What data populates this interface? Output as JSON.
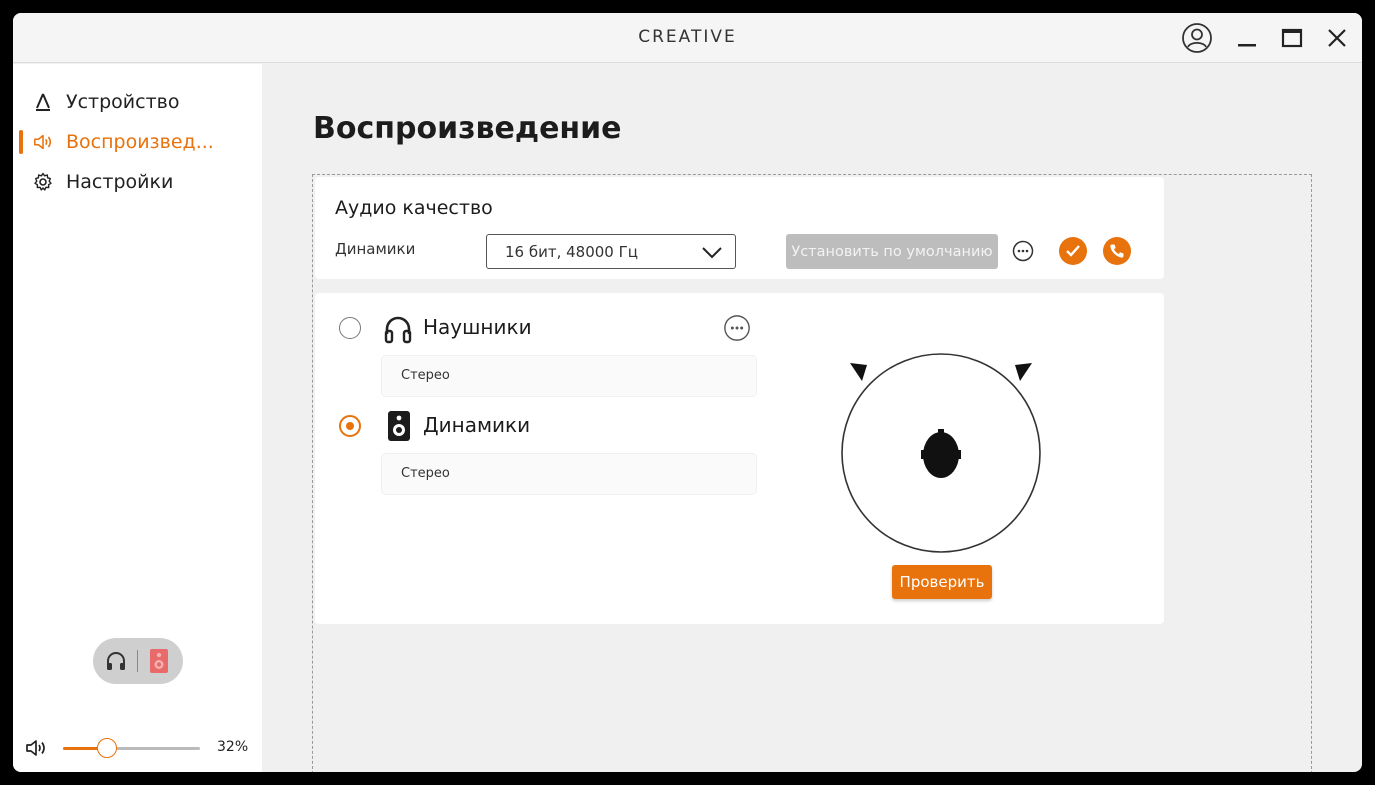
{
  "app": {
    "brand": "CREATIVE"
  },
  "sidebar": {
    "items": [
      {
        "label": "Устройство",
        "icon": "device-icon",
        "active": false
      },
      {
        "label": "Воспроизвед...",
        "icon": "speaker-volume-icon",
        "active": true
      },
      {
        "label": "Настройки",
        "icon": "gear-icon",
        "active": false
      }
    ],
    "output_switch": {
      "left_icon": "headphones-icon",
      "right_icon": "speaker-icon",
      "selected": "speaker"
    },
    "volume": {
      "percent_label": "32%",
      "value": 0.32
    }
  },
  "main": {
    "title": "Воспроизведение",
    "quality": {
      "title": "Аудио качество",
      "device_label": "Динамики",
      "format_value": "16 бит, 48000 Гц",
      "set_default_label": "Установить по умолчанию"
    },
    "outputs": [
      {
        "label": "Наушники",
        "sub": "Стерео",
        "selected": false,
        "icon": "headphones-icon"
      },
      {
        "label": "Динамики",
        "sub": "Стерео",
        "selected": true,
        "icon": "speaker-icon"
      }
    ],
    "test_button": "Проверить"
  },
  "colors": {
    "accent": "#e8720c",
    "disabled": "#bdbdbd"
  }
}
